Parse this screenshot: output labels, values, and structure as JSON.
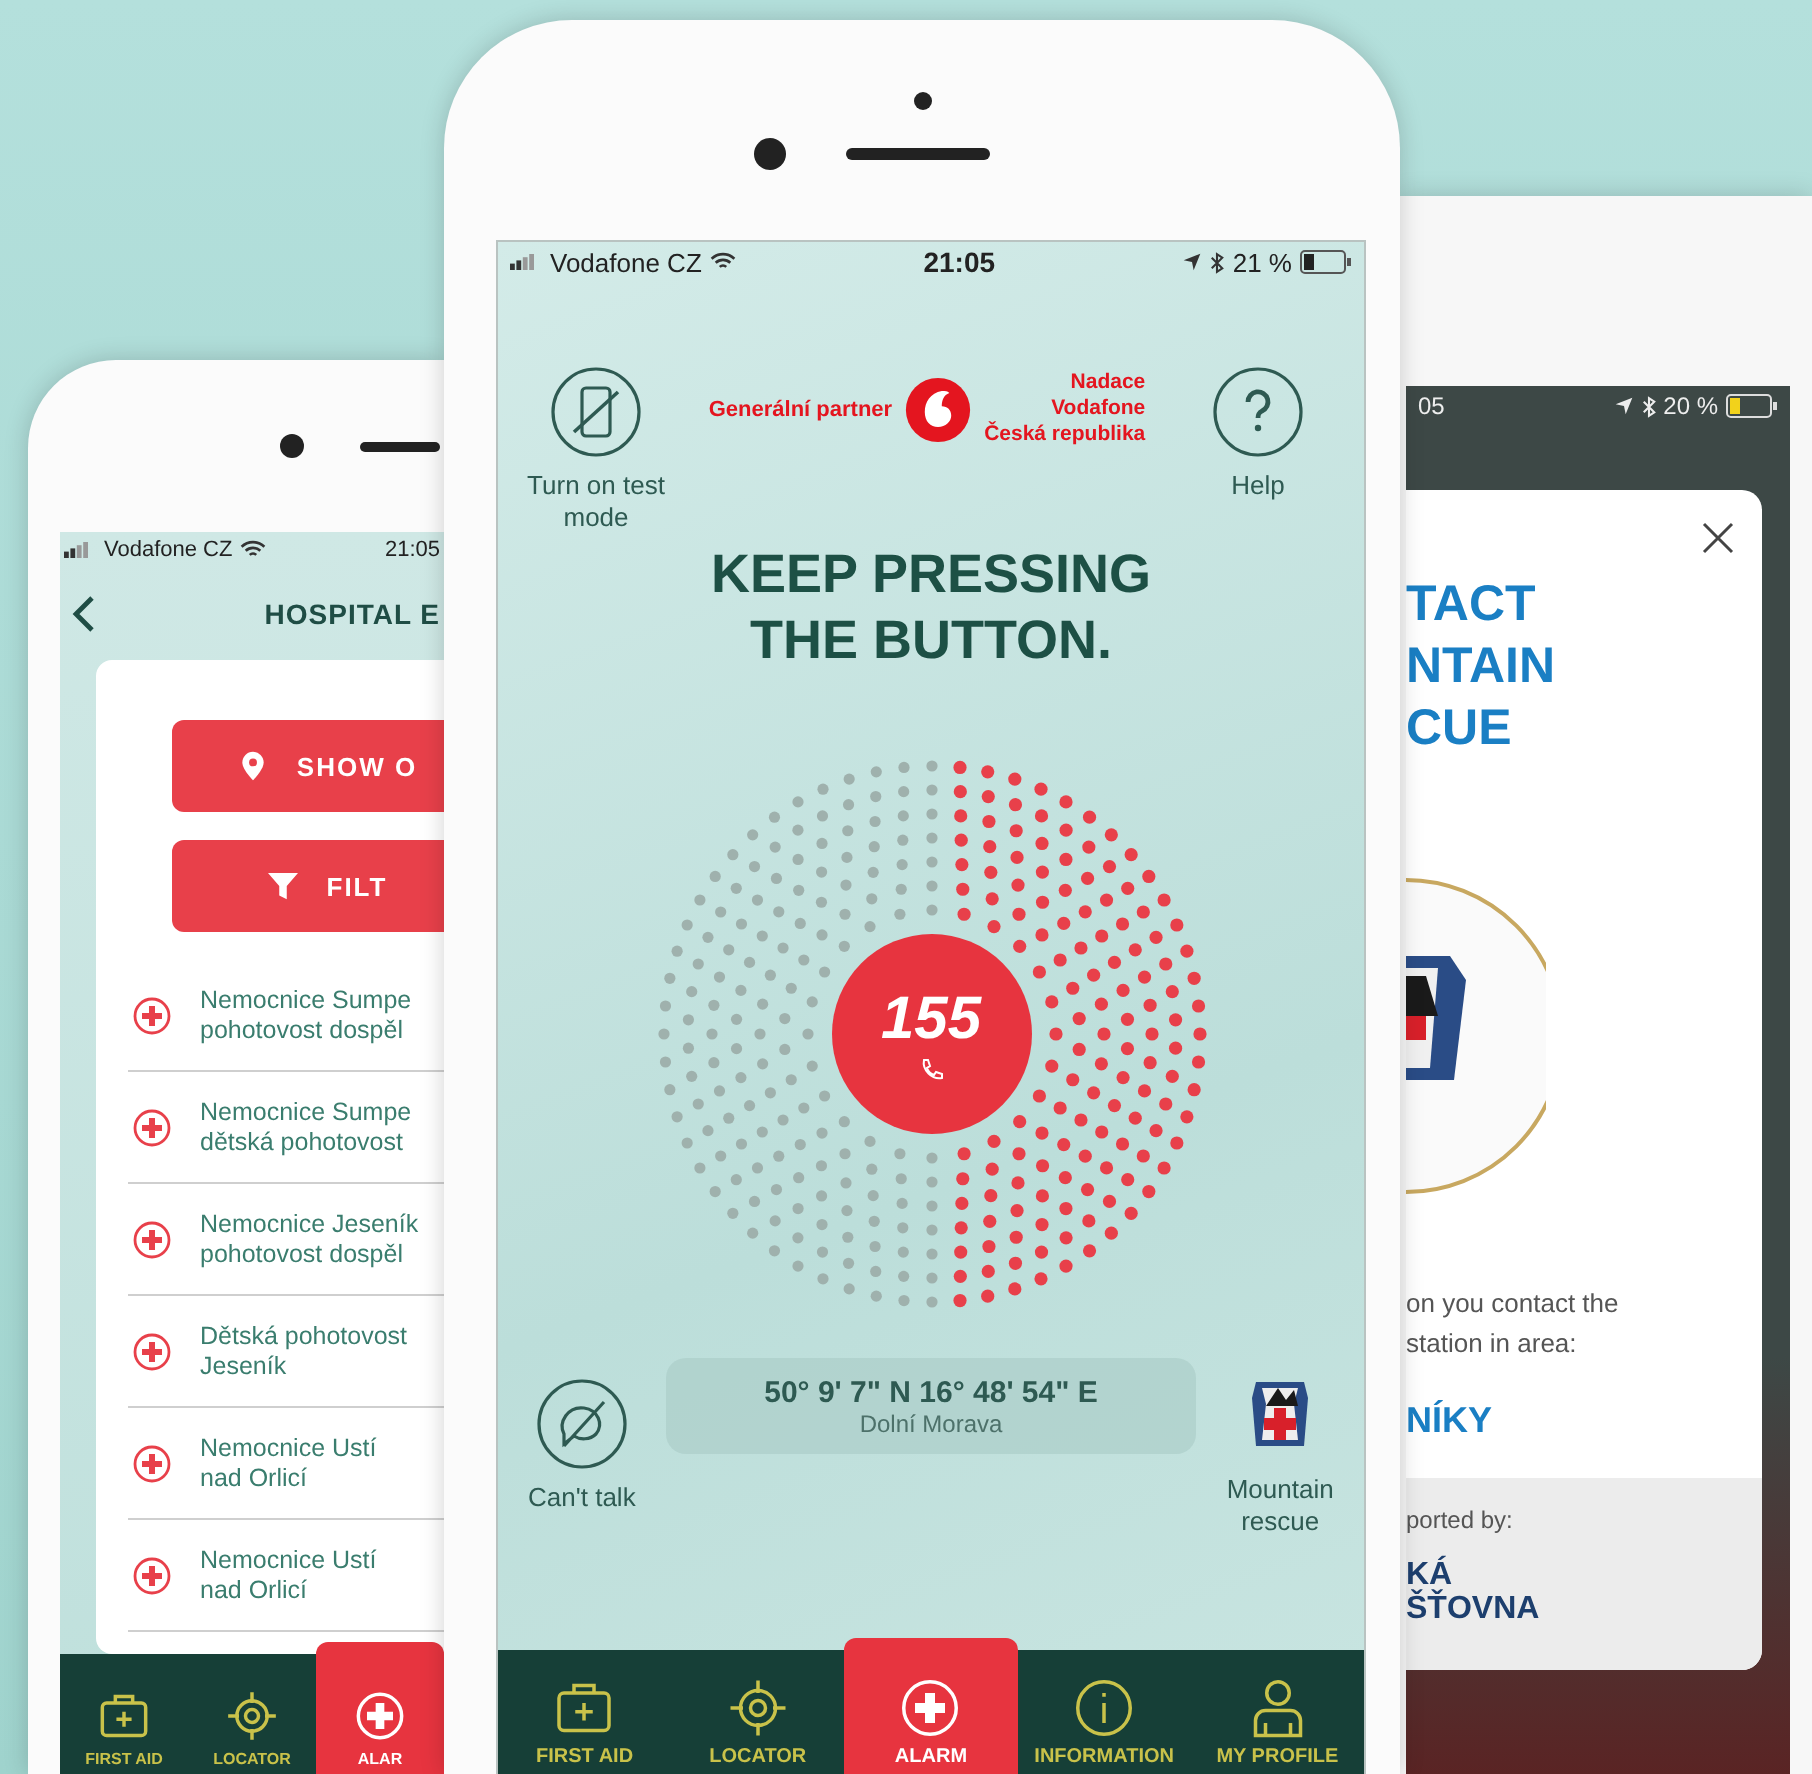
{
  "left_phone": {
    "status_bar": {
      "carrier": "Vodafone CZ",
      "time": "21:05"
    },
    "title": "HOSPITAL E",
    "buttons": [
      {
        "kind": "pin",
        "label": "SHOW O"
      },
      {
        "kind": "filter",
        "label": "FILT"
      }
    ],
    "hospitals": [
      {
        "lines": [
          "Nemocnice Sumpe",
          "pohotovost dospěl"
        ]
      },
      {
        "lines": [
          "Nemocnice Sumpe",
          "dětská pohotovost"
        ]
      },
      {
        "lines": [
          "Nemocnice Jeseník",
          "pohotovost dospěl"
        ]
      },
      {
        "lines": [
          "Dětská pohotovost",
          "Jeseník"
        ]
      },
      {
        "lines": [
          "Nemocnice Ustí",
          "nad Orlicí"
        ]
      },
      {
        "lines": [
          "Nemocnice Ustí",
          "nad Orlicí"
        ]
      }
    ],
    "tabs": [
      {
        "kind": "kit",
        "label": "FIRST AID",
        "selected": false
      },
      {
        "kind": "target",
        "label": "LOCATOR",
        "selected": false
      },
      {
        "kind": "cross",
        "label": "ALAR",
        "selected": true
      }
    ]
  },
  "center_phone": {
    "status_bar": {
      "carrier": "Vodafone CZ",
      "time": "21:05",
      "battery": "21 %"
    },
    "test_mode": "Turn on test mode",
    "partner": "Generální partner",
    "foundation": [
      "Nadace",
      "Vodafone",
      "Česká republika"
    ],
    "help": "Help",
    "headline": [
      "KEEP PRESSING",
      "THE BUTTON."
    ],
    "emergency_number": "155",
    "coordinates": "50° 9' 7\" N 16° 48' 54\" E",
    "place": "Dolní Morava",
    "cant_talk": "Can't talk",
    "mountain_rescue": "Mountain rescue",
    "tabs": [
      {
        "kind": "kit",
        "label": "FIRST AID",
        "selected": false
      },
      {
        "kind": "target",
        "label": "LOCATOR",
        "selected": false
      },
      {
        "kind": "cross",
        "label": "ALARM",
        "selected": true
      },
      {
        "kind": "info",
        "label": "INFORMATION",
        "selected": false
      },
      {
        "kind": "person",
        "label": "MY PROFILE",
        "selected": false
      }
    ]
  },
  "right_phone": {
    "status_bar": {
      "time": "05",
      "battery": "20 %"
    },
    "title": [
      "TACT",
      "NTAIN",
      "CUE"
    ],
    "text": [
      "on you contact the",
      "station in area:"
    ],
    "area": "NÍKY",
    "supported": "ported by:",
    "sponsor": [
      "KÁ",
      "ŠŤOVNA"
    ]
  }
}
